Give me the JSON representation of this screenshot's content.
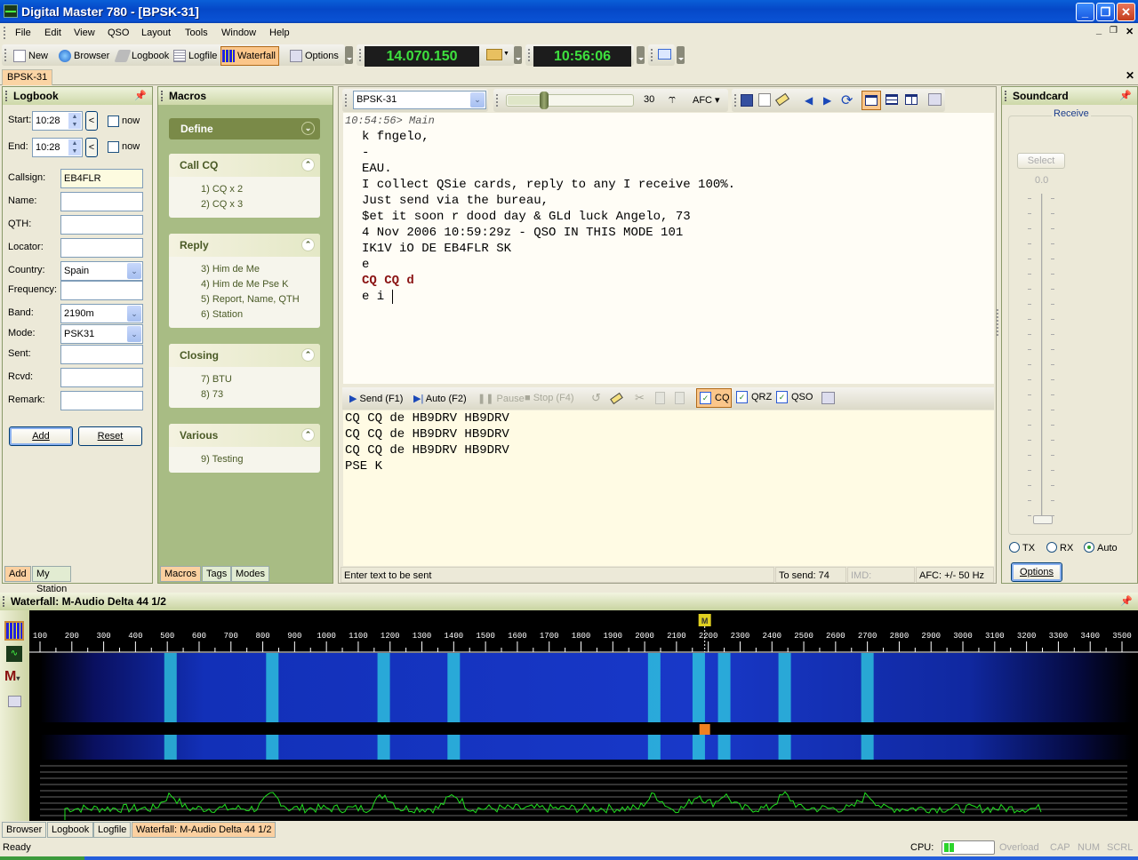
{
  "window": {
    "title": "Digital Master 780 - [BPSK-31]",
    "minimize_label": "_",
    "restore_label": "❐",
    "close_label": "✕"
  },
  "menu": [
    "File",
    "Edit",
    "View",
    "QSO",
    "Layout",
    "Tools",
    "Window",
    "Help"
  ],
  "toolbar": {
    "new": "New",
    "browser": "Browser",
    "logbook": "Logbook",
    "logfile": "Logfile",
    "waterfall": "Waterfall",
    "options": "Options",
    "frequency": "14.070.150",
    "clock": "10:56:06"
  },
  "doc_tabs": [
    "BPSK-31"
  ],
  "logbook": {
    "title": "Logbook",
    "start_label": "Start:",
    "start_value": "10:28",
    "end_label": "End:",
    "end_value": "10:28",
    "now_label": "now",
    "back_label": "<",
    "fields": [
      {
        "label": "Callsign:",
        "value": "EB4FLR"
      },
      {
        "label": "Name:",
        "value": ""
      },
      {
        "label": "QTH:",
        "value": ""
      },
      {
        "label": "Locator:",
        "value": ""
      },
      {
        "label": "Country:",
        "value": "Spain"
      },
      {
        "label": "Frequency:",
        "value": ""
      },
      {
        "label": "Band:",
        "value": "2190m"
      },
      {
        "label": "Mode:",
        "value": "PSK31"
      },
      {
        "label": "Sent:",
        "value": ""
      },
      {
        "label": "Rcvd:",
        "value": ""
      },
      {
        "label": "Remark:",
        "value": ""
      }
    ],
    "add_button": "Add",
    "reset_button": "Reset",
    "tabs": [
      "Add",
      "My Station"
    ]
  },
  "macros": {
    "title": "Macros",
    "define": "Define",
    "groups": [
      {
        "title": "Call CQ",
        "items": [
          "1)  CQ x 2",
          "2)  CQ x 3"
        ]
      },
      {
        "title": "Reply",
        "items": [
          "3)  Him de Me",
          "4)  Him de Me Pse K",
          "5)  Report, Name, QTH",
          "6)  Station"
        ]
      },
      {
        "title": "Closing",
        "items": [
          "7)  BTU",
          "8)  73"
        ]
      },
      {
        "title": "Various",
        "items": [
          "9)  Testing"
        ]
      }
    ],
    "tabs": [
      "Macros",
      "Tags",
      "Modes"
    ]
  },
  "editor": {
    "mode_select": "BPSK-31",
    "squelch_value": "30",
    "squelch_level": 0.3,
    "afc_label": "AFC",
    "rx_header": "10:54:56> Main",
    "rx_lines": [
      "k fngelo,",
      "-",
      "EAU.",
      "I collect QSie cards, reply to any I receive 100%.",
      "Just send via the bureau,",
      "$et it soon r dood day & GLd luck Angelo, 73",
      "4 Nov 2006 10:59:29z - QSO IN THIS MODE 101",
      "IK1V iO DE EB4FLR SK",
      "e"
    ],
    "rx_highlight": "CQ CQ d",
    "rx_last": "e i ",
    "tx_toolbar": {
      "send": "Send (F1)",
      "auto": "Auto (F2)",
      "pause": "Pause",
      "stop": "Stop (F4)",
      "cq": "CQ",
      "qrz": "QRZ",
      "qso": "QSO"
    },
    "tx_lines": [
      "CQ CQ de HB9DRV HB9DRV",
      "CQ CQ de HB9DRV HB9DRV",
      "CQ CQ de HB9DRV HB9DRV",
      "PSE K"
    ],
    "status": {
      "hint": "Enter text to be sent",
      "to_send": "To send: 74",
      "imd": "IMD:",
      "afc": "AFC: +/- 50 Hz"
    }
  },
  "soundcard": {
    "title": "Soundcard",
    "group": "Receive",
    "select": "Select",
    "level": "0.0",
    "level_fraction": 0.0,
    "radios": [
      {
        "label": "TX",
        "checked": false
      },
      {
        "label": "RX",
        "checked": false
      },
      {
        "label": "Auto",
        "checked": true
      }
    ],
    "options": "Options"
  },
  "waterfall": {
    "title": "Waterfall: M-Audio Delta 44 1/2",
    "marker": "M",
    "marker_freq": 2200,
    "scale": [
      100,
      200,
      300,
      400,
      500,
      600,
      700,
      800,
      900,
      1000,
      1100,
      1200,
      1300,
      1400,
      1500,
      1600,
      1700,
      1800,
      1900,
      2000,
      2100,
      2200,
      2300,
      2400,
      2500,
      2600,
      2700,
      2800,
      2900,
      3000,
      3100,
      3200,
      3300,
      3400,
      3500
    ],
    "signals_hz": [
      510,
      830,
      1180,
      1400,
      2030,
      2170,
      2250,
      2440,
      2700
    ]
  },
  "bottom_tabs": [
    "Browser",
    "Logbook",
    "Logfile",
    "Waterfall: M-Audio Delta 44 1/2"
  ],
  "statusbar": {
    "ready": "Ready",
    "cpu_label": "CPU:",
    "cpu_load": 0.2,
    "overload": "Overload",
    "cap": "CAP",
    "num": "NUM",
    "scrl": "SCRL"
  }
}
